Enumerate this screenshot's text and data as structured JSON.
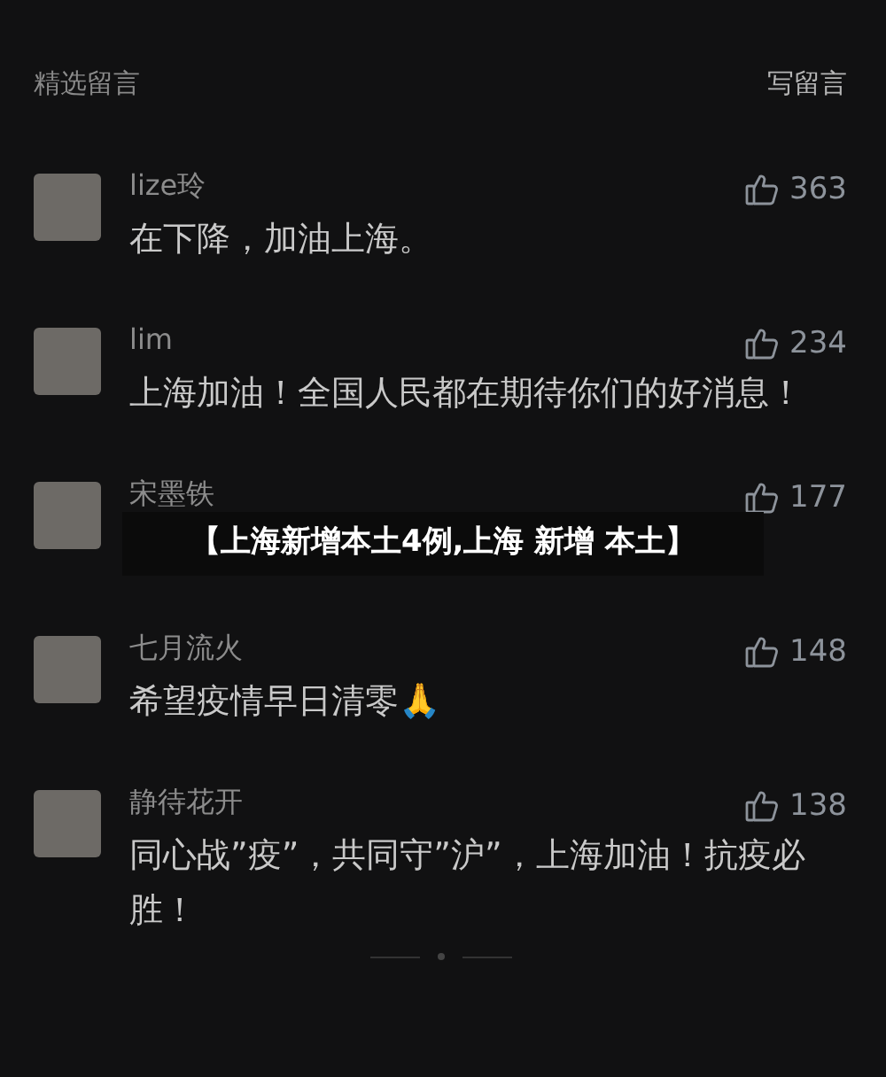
{
  "header": {
    "title": "精选留言",
    "action": "写留言"
  },
  "comments": [
    {
      "user": "lize玲",
      "likes": "363",
      "text": "在下降，加油上海。"
    },
    {
      "user": "lim",
      "likes": "234",
      "text": "上海加油！全国人民都在期待你们的好消息！"
    },
    {
      "user": "宋墨铁",
      "likes": "177"
    },
    {
      "user": "七月流火",
      "likes": "148",
      "text": "希望疫情早日清零🙏"
    },
    {
      "user": "静待花开",
      "likes": "138",
      "text": "同心战”疫”，共同守”沪”，上海加油！抗疫必胜！"
    }
  ],
  "banner": {
    "text": "【上海新增本土4例,上海 新增 本土】"
  }
}
